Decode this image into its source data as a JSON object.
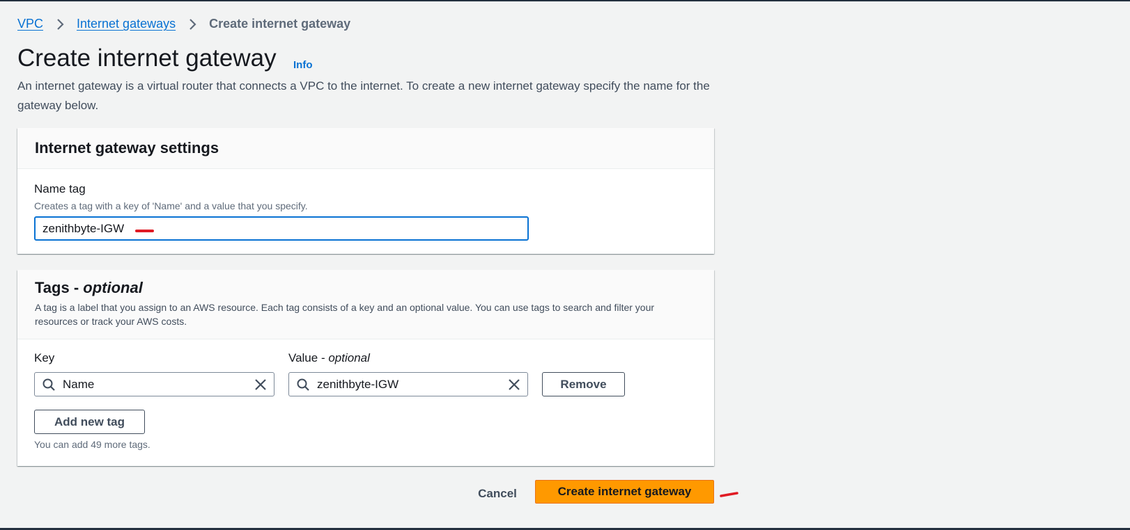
{
  "breadcrumb": {
    "items": [
      "VPC",
      "Internet gateways"
    ],
    "current": "Create internet gateway"
  },
  "header": {
    "title": "Create internet gateway",
    "info": "Info",
    "description": "An internet gateway is a virtual router that connects a VPC to the internet. To create a new internet gateway specify the name for the gateway below."
  },
  "settings": {
    "title": "Internet gateway settings",
    "name_tag_label": "Name tag",
    "name_tag_description": "Creates a tag with a key of 'Name' and a value that you specify.",
    "name_value": "zenithbyte-IGW"
  },
  "tags": {
    "title": "Tags - ",
    "title_optional": "optional",
    "description": "A tag is a label that you assign to an AWS resource. Each tag consists of a key and an optional value. You can use tags to search and filter your resources or track your AWS costs.",
    "key_label": "Key",
    "value_label": "Value - ",
    "value_label_optional": "optional",
    "rows": [
      {
        "key": "Name",
        "value": "zenithbyte-IGW"
      }
    ],
    "remove_label": "Remove",
    "add_label": "Add new tag",
    "remaining_note": "You can add 49 more tags."
  },
  "footer": {
    "cancel_label": "Cancel",
    "create_label": "Create internet gateway"
  },
  "colors": {
    "link": "#0972d3",
    "primary_button": "#ff9900",
    "annotation_mark": "#e01b24",
    "page_background": "#f2f3f3"
  },
  "icons": {
    "breadcrumb_separator": "chevron-right-icon",
    "search": "search-icon",
    "clear": "close-icon"
  }
}
